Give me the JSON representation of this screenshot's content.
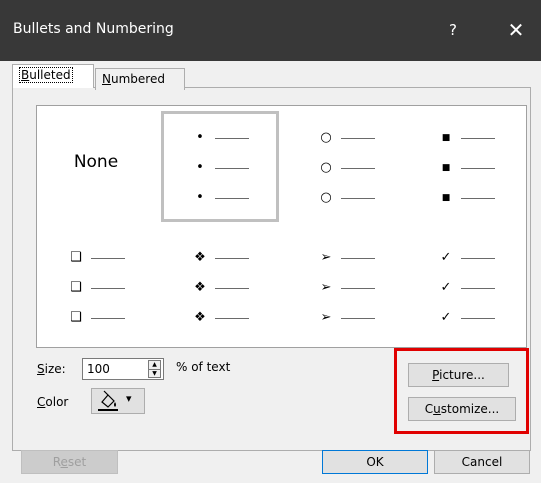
{
  "window": {
    "title": "Bullets and Numbering",
    "help_label": "?",
    "close_label": "✕"
  },
  "tabs": [
    {
      "label": "Bulleted",
      "accel": "B",
      "rest": "ulleted",
      "active": true
    },
    {
      "label": "Numbered",
      "accel": "N",
      "rest": "umbered",
      "active": false
    }
  ],
  "gallery": {
    "cells": [
      {
        "type": "none",
        "label": "None"
      },
      {
        "type": "bullet",
        "char": "•",
        "selected": true
      },
      {
        "type": "bullet",
        "char": "○"
      },
      {
        "type": "bullet",
        "char": "■"
      },
      {
        "type": "bullet",
        "char": "❑"
      },
      {
        "type": "bullet",
        "char": "❖"
      },
      {
        "type": "bullet",
        "char": "➢"
      },
      {
        "type": "bullet",
        "char": "✓"
      }
    ]
  },
  "size": {
    "label_accel": "S",
    "label_rest": "ize:",
    "value": "100",
    "suffix": "% of text"
  },
  "color": {
    "label_accel": "C",
    "label_rest": "olor",
    "dropdown_arrow": "▾"
  },
  "buttons": {
    "picture": {
      "accel": "P",
      "rest": "icture..."
    },
    "customize": {
      "accel": "u",
      "pre": "C",
      "rest": "stomize..."
    },
    "reset": {
      "pre": "R",
      "accel": "e",
      "rest": "set"
    },
    "ok": "OK",
    "cancel": "Cancel"
  }
}
